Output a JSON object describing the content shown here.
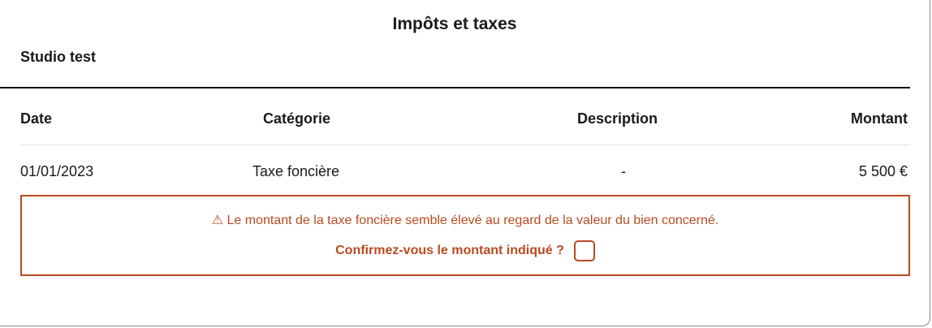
{
  "page": {
    "title": "Impôts et taxes",
    "property_name": "Studio test"
  },
  "table": {
    "headers": {
      "date": "Date",
      "category": "Catégorie",
      "description": "Description",
      "amount": "Montant"
    },
    "rows": [
      {
        "date": "01/01/2023",
        "category": "Taxe foncière",
        "description": "-",
        "amount": "5 500 €"
      }
    ]
  },
  "warning": {
    "icon": "warning-triangle-icon",
    "icon_glyph": "⚠",
    "message": "Le montant de la taxe foncière semble élevé au regard de la valeur du bien concerné.",
    "confirm_label": "Confirmez-vous le montant indiqué ?",
    "confirm_checked": false
  },
  "colors": {
    "accent": "#b94a21",
    "text": "#1a1a1a",
    "divider": "#111111"
  }
}
